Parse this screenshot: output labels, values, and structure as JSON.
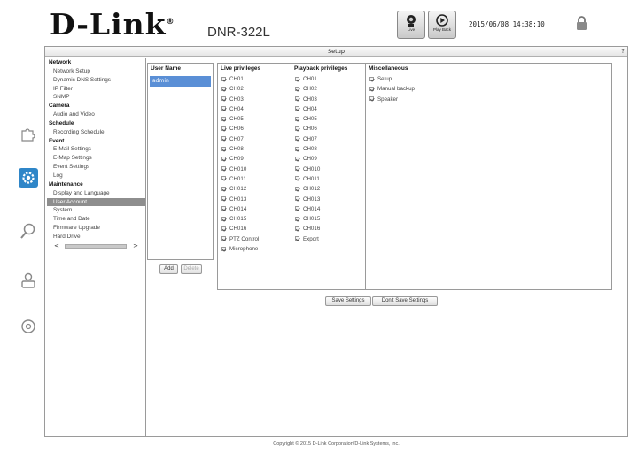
{
  "header": {
    "brand": "D-Link",
    "model": "DNR-322L",
    "live_label": "Live",
    "playback_label": "Play Back",
    "datetime": "2015/06/08 14:38:10"
  },
  "icons": {
    "rail": [
      "puzzle-icon",
      "setup-gear-icon",
      "search-icon",
      "person-icon",
      "disc-icon"
    ],
    "active": "setup-gear-icon"
  },
  "colors": {
    "selection": "#5a8fd6",
    "active_rail": "#2f86c8",
    "sidebar_selected": "#8e8e8e"
  },
  "setup": {
    "title": "Setup",
    "help": "?"
  },
  "sidebar": {
    "items": [
      {
        "label": "Network",
        "type": "cat"
      },
      {
        "label": "Network Setup",
        "type": "item"
      },
      {
        "label": "Dynamic DNS Settings",
        "type": "item"
      },
      {
        "label": "IP Filter",
        "type": "item"
      },
      {
        "label": "SNMP",
        "type": "item"
      },
      {
        "label": "Camera",
        "type": "cat"
      },
      {
        "label": "Audio and Video",
        "type": "item"
      },
      {
        "label": "Schedule",
        "type": "cat"
      },
      {
        "label": "Recording Schedule",
        "type": "item"
      },
      {
        "label": "Event",
        "type": "cat"
      },
      {
        "label": "E-Mail Settings",
        "type": "item"
      },
      {
        "label": "E-Map Settings",
        "type": "item"
      },
      {
        "label": "Event Settings",
        "type": "item"
      },
      {
        "label": "Log",
        "type": "item"
      },
      {
        "label": "Maintenance",
        "type": "cat"
      },
      {
        "label": "Display and Language",
        "type": "item"
      },
      {
        "label": "User Account",
        "type": "item",
        "selected": true
      },
      {
        "label": "System",
        "type": "item"
      },
      {
        "label": "Time and Date",
        "type": "item"
      },
      {
        "label": "Firmware Upgrade",
        "type": "item"
      },
      {
        "label": "Hard Drive",
        "type": "item"
      }
    ],
    "scroll_left": "<",
    "scroll_right": ">"
  },
  "users": {
    "header": "User Name",
    "list": [
      "admin"
    ],
    "add_label": "Add",
    "delete_label": "Delete"
  },
  "privileges": {
    "live": {
      "header": "Live privileges",
      "items": [
        "CH01",
        "CH02",
        "CH03",
        "CH04",
        "CH05",
        "CH06",
        "CH07",
        "CH08",
        "CH09",
        "CH010",
        "CH011",
        "CH012",
        "CH013",
        "CH014",
        "CH015",
        "CH016",
        "PTZ Control",
        "Microphone"
      ]
    },
    "playback": {
      "header": "Playback privileges",
      "items": [
        "CH01",
        "CH02",
        "CH03",
        "CH04",
        "CH05",
        "CH06",
        "CH07",
        "CH08",
        "CH09",
        "CH010",
        "CH011",
        "CH012",
        "CH013",
        "CH014",
        "CH015",
        "CH016",
        "Export"
      ]
    },
    "misc": {
      "header": "Miscellaneous",
      "items": [
        "Setup",
        "Manual backup",
        "Speaker"
      ]
    }
  },
  "actions": {
    "save": "Save Settings",
    "dont_save": "Don't Save Settings"
  },
  "footer": "Copyright © 2015 D-Link Corporation/D-Link Systems, Inc."
}
